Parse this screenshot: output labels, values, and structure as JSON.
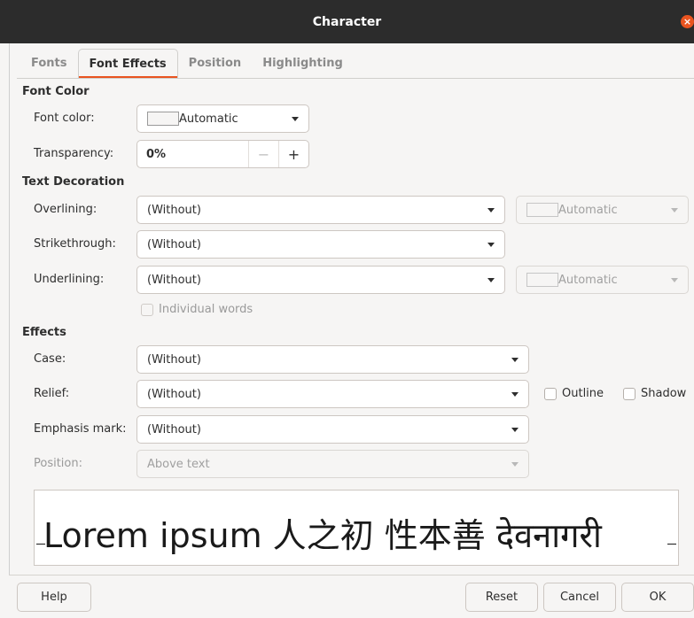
{
  "window": {
    "title": "Character",
    "close_glyph": "×"
  },
  "tabs": [
    {
      "label": "Fonts"
    },
    {
      "label": "Font Effects"
    },
    {
      "label": "Position"
    },
    {
      "label": "Highlighting"
    }
  ],
  "font_color": {
    "section": "Font Color",
    "color_label": "Font color:",
    "color_value": "Automatic",
    "transparency_label": "Transparency:",
    "transparency_value": "0%",
    "minus": "−",
    "plus": "+"
  },
  "text_decoration": {
    "section": "Text Decoration",
    "overlining_label": "Overlining:",
    "overlining_value": "(Without)",
    "overlining_color": "Automatic",
    "strikethrough_label": "Strikethrough:",
    "strikethrough_value": "(Without)",
    "underlining_label": "Underlining:",
    "underlining_value": "(Without)",
    "underlining_color": "Automatic",
    "individual_words": "Individual words"
  },
  "effects": {
    "section": "Effects",
    "case_label": "Case:",
    "case_value": "(Without)",
    "relief_label": "Relief:",
    "relief_value": "(Without)",
    "outline_label": "Outline",
    "shadow_label": "Shadow",
    "emphasis_label": "Emphasis mark:",
    "emphasis_value": "(Without)",
    "position_label": "Position:",
    "position_value": "Above text"
  },
  "preview": {
    "text": "Lorem ipsum  人之初 性本善  देवनागरी"
  },
  "buttons": {
    "help": "Help",
    "reset": "Reset",
    "cancel": "Cancel",
    "ok": "OK"
  },
  "colors": {
    "accent": "#e95420",
    "titlebar": "#2c2c2c",
    "background": "#f6f5f4"
  }
}
